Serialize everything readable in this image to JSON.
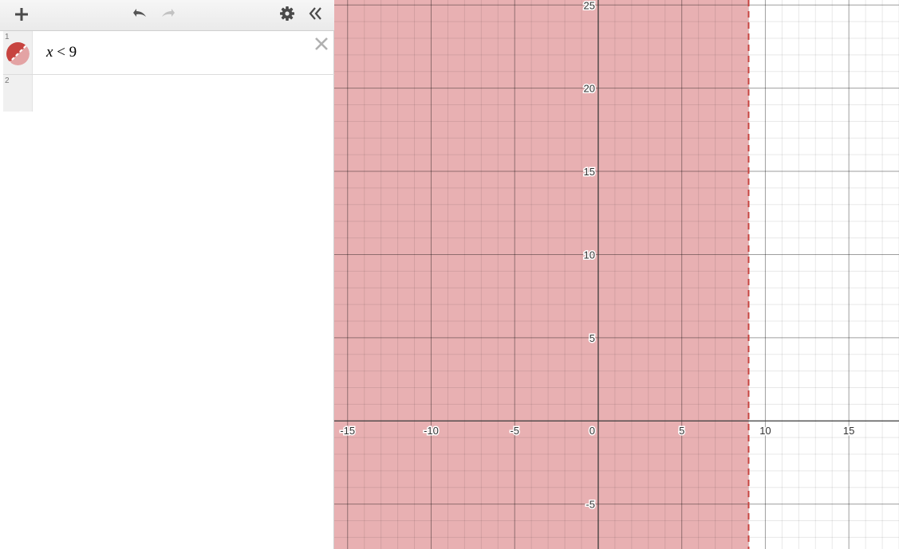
{
  "toolbar": {
    "icons": [
      "plus-icon",
      "undo-icon",
      "redo-icon",
      "gear-icon",
      "double-chevron-left-icon"
    ]
  },
  "expressions": [
    {
      "index": "1",
      "variable": "x",
      "operator": "<",
      "value": "9",
      "color": "#c74440"
    },
    {
      "index": "2"
    }
  ],
  "graph": {
    "x_range": [
      -15.8,
      18.0
    ],
    "y_range": [
      -7.7,
      25.3
    ],
    "minor_step": 1,
    "major_step": 5,
    "x_tick_labels": [
      "-15",
      "-10",
      "-5",
      "0",
      "5",
      "10",
      "15"
    ],
    "x_tick_values": [
      -15,
      -10,
      -5,
      0,
      5,
      10,
      15
    ],
    "y_tick_labels": [
      "25",
      "20",
      "15",
      "10",
      "5",
      "-5"
    ],
    "y_tick_values": [
      25,
      20,
      15,
      10,
      5,
      -5
    ],
    "inequality": {
      "boundary_x": 9,
      "shade": "left",
      "line_style": "dashed",
      "color": "#c74440",
      "fill": "#e8b0b2"
    }
  }
}
